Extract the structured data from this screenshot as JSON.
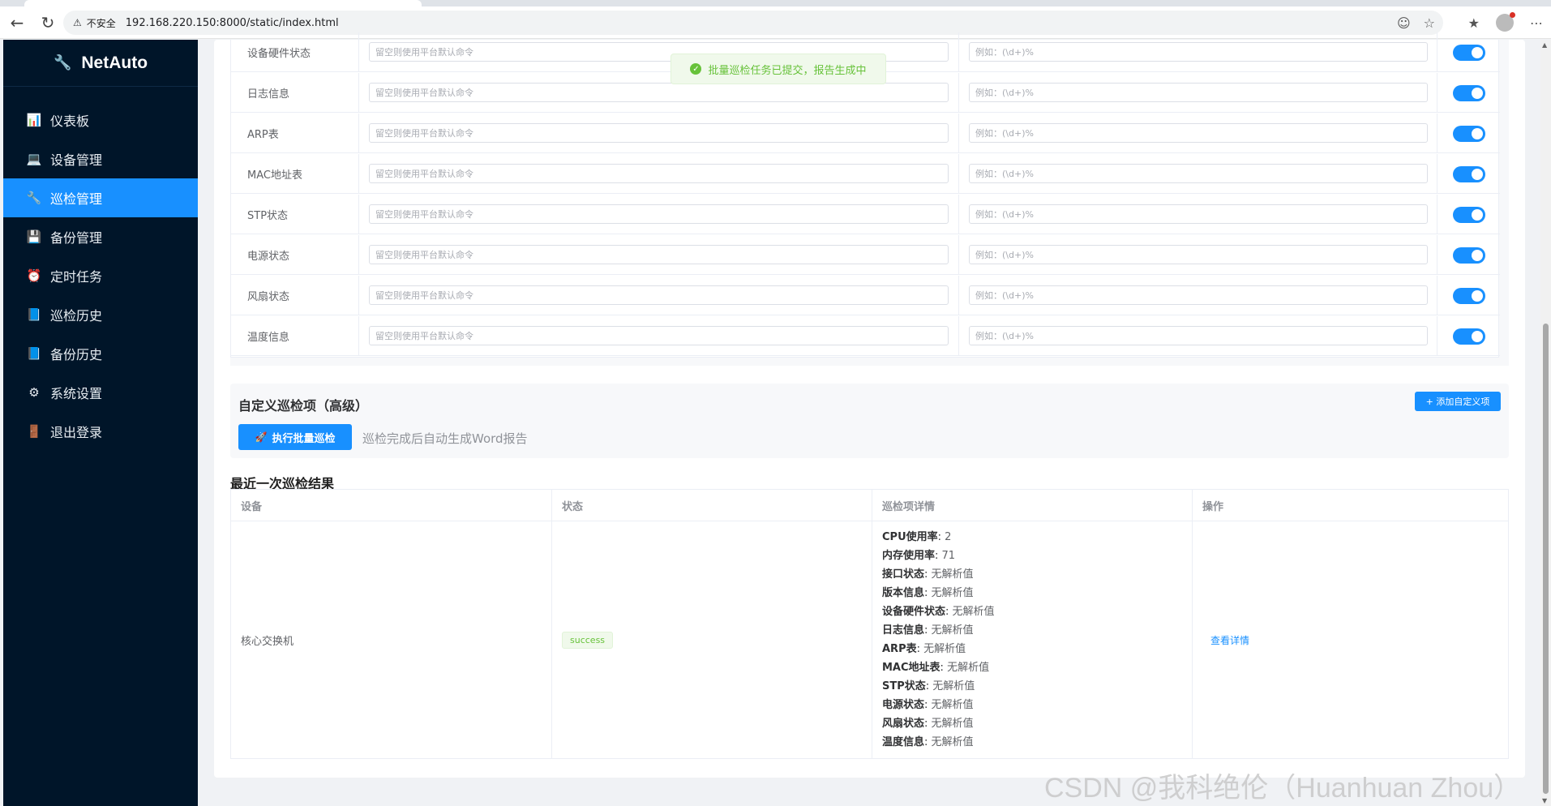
{
  "browser": {
    "security_label": "不安全",
    "url": "192.168.220.150:8000/static/index.html"
  },
  "app": {
    "title": "NetAuto"
  },
  "sidebar": {
    "items": [
      {
        "label": "仪表板",
        "icon": "dashboard-icon"
      },
      {
        "label": "设备管理",
        "icon": "device-icon"
      },
      {
        "label": "巡检管理",
        "icon": "wrench-icon",
        "active": true
      },
      {
        "label": "备份管理",
        "icon": "floppy-icon"
      },
      {
        "label": "定时任务",
        "icon": "alarm-icon"
      },
      {
        "label": "巡检历史",
        "icon": "book-icon"
      },
      {
        "label": "备份历史",
        "icon": "book-icon"
      },
      {
        "label": "系统设置",
        "icon": "gear-icon"
      },
      {
        "label": "退出登录",
        "icon": "door-icon"
      }
    ]
  },
  "toast": {
    "message": "批量巡检任务已提交，报告生成中"
  },
  "inspection_items": {
    "command_placeholder": "留空则使用平台默认命令",
    "regex_placeholder": "例如：(\\d+)%",
    "rows": [
      {
        "name": "设备硬件状态",
        "enabled": true
      },
      {
        "name": "日志信息",
        "enabled": true
      },
      {
        "name": "ARP表",
        "enabled": true
      },
      {
        "name": "MAC地址表",
        "enabled": true
      },
      {
        "name": "STP状态",
        "enabled": true
      },
      {
        "name": "电源状态",
        "enabled": true
      },
      {
        "name": "风扇状态",
        "enabled": true
      },
      {
        "name": "温度信息",
        "enabled": true
      }
    ]
  },
  "custom": {
    "title": "自定义巡检项（高级）",
    "add_button": "+ 添加自定义项",
    "run_button": "执行批量巡检",
    "run_hint": "巡检完成后自动生成Word报告"
  },
  "results": {
    "title": "最近一次巡检结果",
    "columns": [
      "设备",
      "状态",
      "巡检项详情",
      "操作"
    ],
    "row": {
      "device": "核心交换机",
      "status": "success",
      "action": "查看详情",
      "details": [
        {
          "key": "CPU使用率",
          "value": "2"
        },
        {
          "key": "内存使用率",
          "value": "71"
        },
        {
          "key": "接口状态",
          "value": "无解析值"
        },
        {
          "key": "版本信息",
          "value": "无解析值"
        },
        {
          "key": "设备硬件状态",
          "value": "无解析值"
        },
        {
          "key": "日志信息",
          "value": "无解析值"
        },
        {
          "key": "ARP表",
          "value": "无解析值"
        },
        {
          "key": "MAC地址表",
          "value": "无解析值"
        },
        {
          "key": "STP状态",
          "value": "无解析值"
        },
        {
          "key": "电源状态",
          "value": "无解析值"
        },
        {
          "key": "风扇状态",
          "value": "无解析值"
        },
        {
          "key": "温度信息",
          "value": "无解析值"
        }
      ]
    }
  },
  "watermark": "CSDN @我科绝伦（Huanhuan Zhou）",
  "colors": {
    "primary": "#1890ff",
    "sidebar_bg": "#001529",
    "success": "#67c23a"
  }
}
